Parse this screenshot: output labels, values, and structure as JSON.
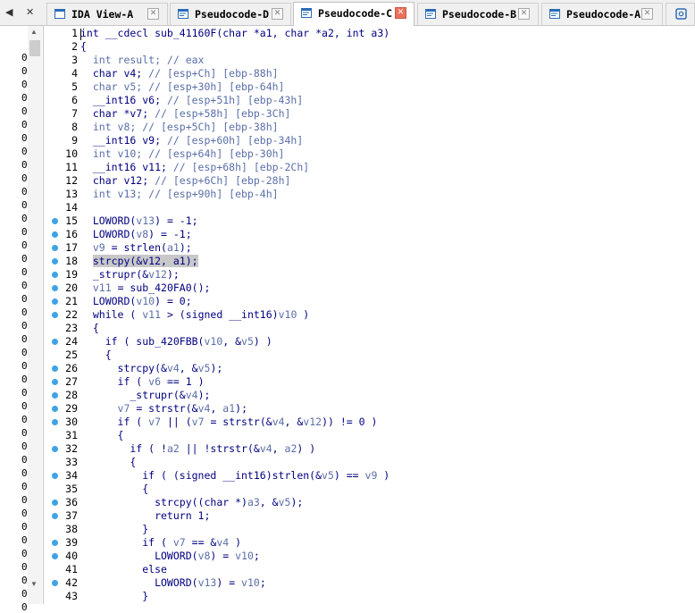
{
  "left_tab_controls": {
    "prev": "◀",
    "close": "✕"
  },
  "tabs": [
    {
      "label": "IDA View-A",
      "icon": "ida-view-icon",
      "active": false
    },
    {
      "label": "Pseudocode-D",
      "icon": "pseudocode-icon",
      "active": false
    },
    {
      "label": "Pseudocode-C",
      "icon": "pseudocode-icon",
      "active": true
    },
    {
      "label": "Pseudocode-B",
      "icon": "pseudocode-icon",
      "active": false
    },
    {
      "label": "Pseudocode-A",
      "icon": "pseudocode-icon",
      "active": false
    }
  ],
  "side_panel": {
    "zero": "0",
    "zero_count": 42
  },
  "code": {
    "breakpoint_color": "#3ea3e8",
    "lines": [
      {
        "n": "1",
        "bp": false,
        "segs": [
          [
            "int __cdecl sub_41160F(char *a1, char *a2, int a3)",
            "c"
          ]
        ]
      },
      {
        "n": "2",
        "bp": false,
        "segs": [
          [
            "{",
            "c"
          ]
        ]
      },
      {
        "n": "3",
        "bp": false,
        "segs": [
          [
            "  int result; // eax",
            "v"
          ]
        ]
      },
      {
        "n": "4",
        "bp": false,
        "segs": [
          [
            "  char v4; ",
            "c"
          ],
          [
            "// [esp+Ch] [ebp-88h]",
            "v"
          ]
        ]
      },
      {
        "n": "5",
        "bp": false,
        "segs": [
          [
            "  char v5; // [esp+30h] [ebp-64h]",
            "v"
          ]
        ]
      },
      {
        "n": "6",
        "bp": false,
        "segs": [
          [
            "  __int16 v6; ",
            "c"
          ],
          [
            "// [esp+51h] [ebp-43h]",
            "v"
          ]
        ]
      },
      {
        "n": "7",
        "bp": false,
        "segs": [
          [
            "  char *v7; ",
            "c"
          ],
          [
            "// [esp+58h] [ebp-3Ch]",
            "v"
          ]
        ]
      },
      {
        "n": "8",
        "bp": false,
        "segs": [
          [
            "  int v8; // [esp+5Ch] [ebp-38h]",
            "v"
          ]
        ]
      },
      {
        "n": "9",
        "bp": false,
        "segs": [
          [
            "  __int16 v9; ",
            "c"
          ],
          [
            "// [esp+60h] [ebp-34h]",
            "v"
          ]
        ]
      },
      {
        "n": "10",
        "bp": false,
        "segs": [
          [
            "  int v10; // [esp+64h] [ebp-30h]",
            "v"
          ]
        ]
      },
      {
        "n": "11",
        "bp": false,
        "segs": [
          [
            "  __int16 v11; ",
            "c"
          ],
          [
            "// [esp+68h] [ebp-2Ch]",
            "v"
          ]
        ]
      },
      {
        "n": "12",
        "bp": false,
        "segs": [
          [
            "  char v12; ",
            "c"
          ],
          [
            "// [esp+6Ch] [ebp-28h]",
            "v"
          ]
        ]
      },
      {
        "n": "13",
        "bp": false,
        "segs": [
          [
            "  int v13; // [esp+90h] [ebp-4h]",
            "v"
          ]
        ]
      },
      {
        "n": "14",
        "bp": false,
        "segs": [
          [
            "",
            "c"
          ]
        ]
      },
      {
        "n": "15",
        "bp": true,
        "segs": [
          [
            "  LOWORD(",
            "c"
          ],
          [
            "v13",
            "v"
          ],
          [
            ") = -1;",
            "c"
          ]
        ]
      },
      {
        "n": "16",
        "bp": true,
        "segs": [
          [
            "  LOWORD(",
            "c"
          ],
          [
            "v8",
            "v"
          ],
          [
            ") = -1;",
            "c"
          ]
        ]
      },
      {
        "n": "17",
        "bp": true,
        "segs": [
          [
            "  ",
            "c"
          ],
          [
            "v9",
            "v"
          ],
          [
            " = strlen(",
            "c"
          ],
          [
            "a1",
            "v"
          ],
          [
            ");",
            "c"
          ]
        ]
      },
      {
        "n": "18",
        "bp": true,
        "segs": [
          [
            "  ",
            "c"
          ],
          [
            "strcpy(&v12, a1);",
            "h"
          ]
        ]
      },
      {
        "n": "19",
        "bp": true,
        "segs": [
          [
            "  _strupr(&",
            "c"
          ],
          [
            "v12",
            "v"
          ],
          [
            ");",
            "c"
          ]
        ]
      },
      {
        "n": "20",
        "bp": true,
        "segs": [
          [
            "  ",
            "c"
          ],
          [
            "v11",
            "v"
          ],
          [
            " = sub_420FA0();",
            "c"
          ]
        ]
      },
      {
        "n": "21",
        "bp": true,
        "segs": [
          [
            "  LOWORD(",
            "c"
          ],
          [
            "v10",
            "v"
          ],
          [
            ") = 0;",
            "c"
          ]
        ]
      },
      {
        "n": "22",
        "bp": true,
        "segs": [
          [
            "  while ( ",
            "c"
          ],
          [
            "v11",
            "v"
          ],
          [
            " > (signed __int16)",
            "c"
          ],
          [
            "v10",
            "v"
          ],
          [
            " )",
            "c"
          ]
        ]
      },
      {
        "n": "23",
        "bp": false,
        "segs": [
          [
            "  {",
            "c"
          ]
        ]
      },
      {
        "n": "24",
        "bp": true,
        "segs": [
          [
            "    if ( sub_420FBB(",
            "c"
          ],
          [
            "v10",
            "v"
          ],
          [
            ", &",
            "c"
          ],
          [
            "v5",
            "v"
          ],
          [
            ") )",
            "c"
          ]
        ]
      },
      {
        "n": "25",
        "bp": false,
        "segs": [
          [
            "    {",
            "c"
          ]
        ]
      },
      {
        "n": "26",
        "bp": true,
        "segs": [
          [
            "      strcpy(&",
            "c"
          ],
          [
            "v4",
            "v"
          ],
          [
            ", &",
            "c"
          ],
          [
            "v5",
            "v"
          ],
          [
            ");",
            "c"
          ]
        ]
      },
      {
        "n": "27",
        "bp": true,
        "segs": [
          [
            "      if ( ",
            "c"
          ],
          [
            "v6",
            "v"
          ],
          [
            " == 1 )",
            "c"
          ]
        ]
      },
      {
        "n": "28",
        "bp": true,
        "segs": [
          [
            "        _strupr(&",
            "c"
          ],
          [
            "v4",
            "v"
          ],
          [
            ");",
            "c"
          ]
        ]
      },
      {
        "n": "29",
        "bp": true,
        "segs": [
          [
            "      ",
            "c"
          ],
          [
            "v7",
            "v"
          ],
          [
            " = strstr(&",
            "c"
          ],
          [
            "v4",
            "v"
          ],
          [
            ", ",
            "c"
          ],
          [
            "a1",
            "v"
          ],
          [
            ");",
            "c"
          ]
        ]
      },
      {
        "n": "30",
        "bp": true,
        "segs": [
          [
            "      if ( ",
            "c"
          ],
          [
            "v7",
            "v"
          ],
          [
            " || (",
            "c"
          ],
          [
            "v7",
            "v"
          ],
          [
            " = strstr(&",
            "c"
          ],
          [
            "v4",
            "v"
          ],
          [
            ", &",
            "c"
          ],
          [
            "v12",
            "v"
          ],
          [
            ")) != 0 )",
            "c"
          ]
        ]
      },
      {
        "n": "31",
        "bp": false,
        "segs": [
          [
            "      {",
            "c"
          ]
        ]
      },
      {
        "n": "32",
        "bp": true,
        "segs": [
          [
            "        if ( !",
            "c"
          ],
          [
            "a2",
            "v"
          ],
          [
            " || !strstr(&",
            "c"
          ],
          [
            "v4",
            "v"
          ],
          [
            ", ",
            "c"
          ],
          [
            "a2",
            "v"
          ],
          [
            ") )",
            "c"
          ]
        ]
      },
      {
        "n": "33",
        "bp": false,
        "segs": [
          [
            "        {",
            "c"
          ]
        ]
      },
      {
        "n": "34",
        "bp": true,
        "segs": [
          [
            "          if ( (signed __int16)strlen(&",
            "c"
          ],
          [
            "v5",
            "v"
          ],
          [
            ") == ",
            "c"
          ],
          [
            "v9",
            "v"
          ],
          [
            " )",
            "c"
          ]
        ]
      },
      {
        "n": "35",
        "bp": false,
        "segs": [
          [
            "          {",
            "c"
          ]
        ]
      },
      {
        "n": "36",
        "bp": true,
        "segs": [
          [
            "            strcpy((char *)",
            "c"
          ],
          [
            "a3",
            "v"
          ],
          [
            ", &",
            "c"
          ],
          [
            "v5",
            "v"
          ],
          [
            ");",
            "c"
          ]
        ]
      },
      {
        "n": "37",
        "bp": true,
        "segs": [
          [
            "            return 1;",
            "c"
          ]
        ]
      },
      {
        "n": "38",
        "bp": false,
        "segs": [
          [
            "          }",
            "c"
          ]
        ]
      },
      {
        "n": "39",
        "bp": true,
        "segs": [
          [
            "          if ( ",
            "c"
          ],
          [
            "v7",
            "v"
          ],
          [
            " == &",
            "c"
          ],
          [
            "v4",
            "v"
          ],
          [
            " )",
            "c"
          ]
        ]
      },
      {
        "n": "40",
        "bp": true,
        "segs": [
          [
            "            LOWORD(",
            "c"
          ],
          [
            "v8",
            "v"
          ],
          [
            ") = ",
            "c"
          ],
          [
            "v10",
            "v"
          ],
          [
            ";",
            "c"
          ]
        ]
      },
      {
        "n": "41",
        "bp": false,
        "segs": [
          [
            "          else",
            "c"
          ]
        ]
      },
      {
        "n": "42",
        "bp": true,
        "segs": [
          [
            "            LOWORD(",
            "c"
          ],
          [
            "v13",
            "v"
          ],
          [
            ") = ",
            "c"
          ],
          [
            "v10",
            "v"
          ],
          [
            ";",
            "c"
          ]
        ]
      },
      {
        "n": "43",
        "bp": false,
        "segs": [
          [
            "          }",
            "c"
          ]
        ]
      }
    ]
  }
}
